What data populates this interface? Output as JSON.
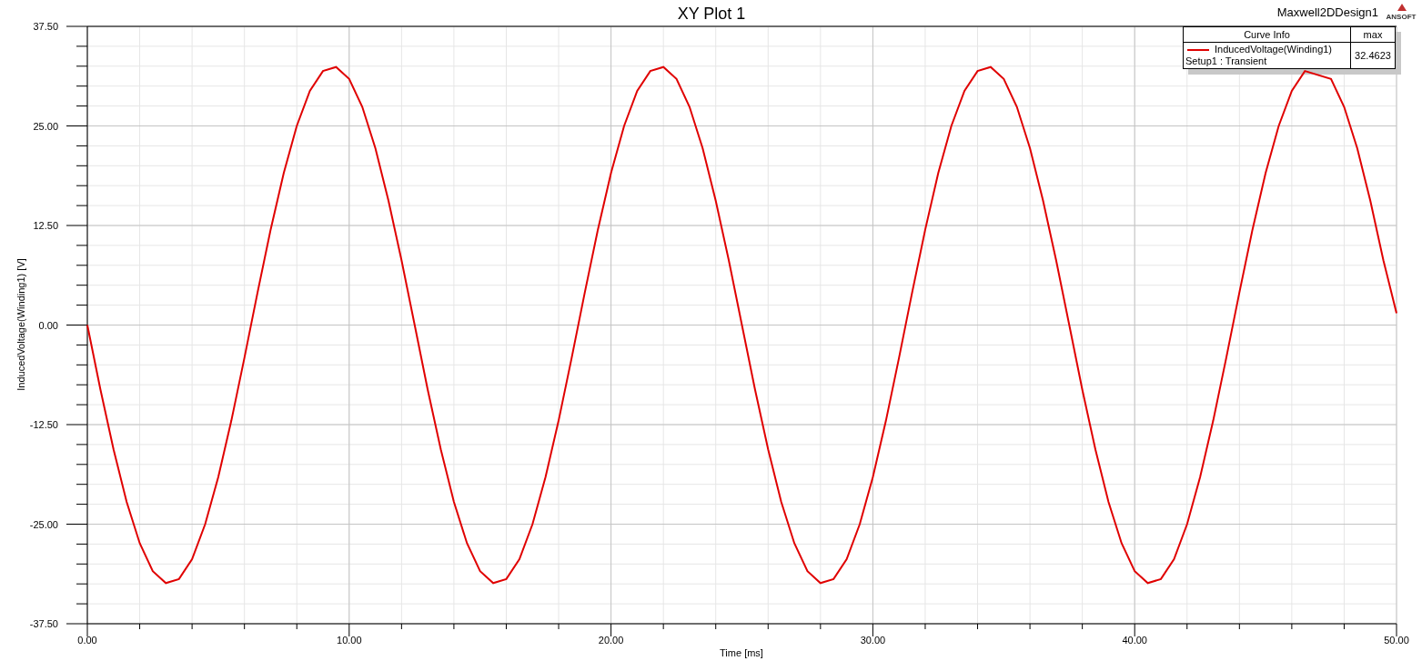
{
  "window": {
    "design": "Maxwell2DDesign1",
    "logo": "ANSOFT"
  },
  "plot": {
    "chart_data": {
      "type": "line",
      "title": "XY Plot 1",
      "xlabel": "Time [ms]",
      "ylabel": "InducedVoltage(Winding1) [V]",
      "x": [
        0,
        0.5,
        1,
        1.5,
        2,
        2.5,
        3,
        3.5,
        4,
        4.5,
        5,
        5.5,
        6,
        6.5,
        7,
        7.5,
        8,
        8.5,
        9,
        9.5,
        10,
        10.5,
        11,
        11.5,
        12,
        12.5,
        13,
        13.5,
        14,
        14.5,
        15,
        15.5,
        16,
        16.5,
        17,
        17.5,
        18,
        18.5,
        19,
        19.5,
        20,
        20.5,
        21,
        21.5,
        22,
        22.5,
        23,
        23.5,
        24,
        24.5,
        25,
        25.5,
        26,
        26.5,
        27,
        27.5,
        28,
        28.5,
        29,
        29.5,
        30,
        30.5,
        31,
        31.5,
        32,
        32.5,
        33,
        33.5,
        34,
        34.5,
        35,
        35.5,
        36,
        36.5,
        37,
        37.5,
        38,
        38.5,
        39,
        39.5,
        40,
        40.5,
        41,
        41.5,
        42,
        42.5,
        43,
        43.5,
        44,
        44.5,
        45,
        45.5,
        46,
        46.5,
        47.5,
        48,
        48.5,
        49,
        49.5,
        50
      ],
      "series": [
        {
          "name": "InducedVoltage(Winding1)",
          "color": "#e00000",
          "values": [
            0,
            -8.1,
            -15.6,
            -22.2,
            -27.4,
            -30.9,
            -32.4,
            -31.9,
            -29.4,
            -25,
            -19.1,
            -12,
            -4.1,
            4.1,
            12,
            19.1,
            25,
            29.4,
            31.9,
            32.4,
            30.9,
            27.4,
            22.2,
            15.6,
            8.1,
            0,
            -8.1,
            -15.6,
            -22.2,
            -27.4,
            -30.9,
            -32.4,
            -31.9,
            -29.4,
            -25,
            -19.1,
            -12,
            -4.1,
            4.1,
            12,
            19.1,
            25,
            29.4,
            31.9,
            32.4,
            30.9,
            27.4,
            22.2,
            15.6,
            8.1,
            0,
            -8.1,
            -15.6,
            -22.2,
            -27.4,
            -30.9,
            -32.4,
            -31.9,
            -29.4,
            -25,
            -19.1,
            -12,
            -4.1,
            4.1,
            12,
            19.1,
            25,
            29.4,
            31.9,
            32.4,
            30.9,
            27.4,
            22.2,
            15.6,
            8.1,
            0,
            -8.1,
            -15.6,
            -22.2,
            -27.4,
            -30.9,
            -32.4,
            -31.9,
            -29.4,
            -25,
            -19.1,
            -12,
            -4.1,
            4.1,
            12,
            19.1,
            25,
            29.4,
            31.9,
            30.9,
            27.4,
            22.2,
            15.6,
            8.1,
            1.5
          ]
        }
      ],
      "grid": true,
      "xlim": [
        0,
        50
      ],
      "ylim": [
        -37.5,
        37.5
      ],
      "xticks": [
        {
          "value": 0,
          "label": "0.00"
        },
        {
          "value": 10,
          "label": "10.00"
        },
        {
          "value": 20,
          "label": "20.00"
        },
        {
          "value": 30,
          "label": "30.00"
        },
        {
          "value": 40,
          "label": "40.00"
        },
        {
          "value": 50,
          "label": "50.00"
        }
      ],
      "yticks": [
        {
          "value": 37.5,
          "label": "37.50"
        },
        {
          "value": 25,
          "label": "25.00"
        },
        {
          "value": 12.5,
          "label": "12.50"
        },
        {
          "value": 0,
          "label": "0.00"
        },
        {
          "value": -12.5,
          "label": "-12.50"
        },
        {
          "value": -25,
          "label": "-25.00"
        },
        {
          "value": -37.5,
          "label": "-37.50"
        }
      ]
    }
  },
  "legend": {
    "header": "Curve Info",
    "column": "max",
    "entries": [
      {
        "setup": "Setup1 : Transient",
        "max": "32.4623"
      }
    ]
  }
}
